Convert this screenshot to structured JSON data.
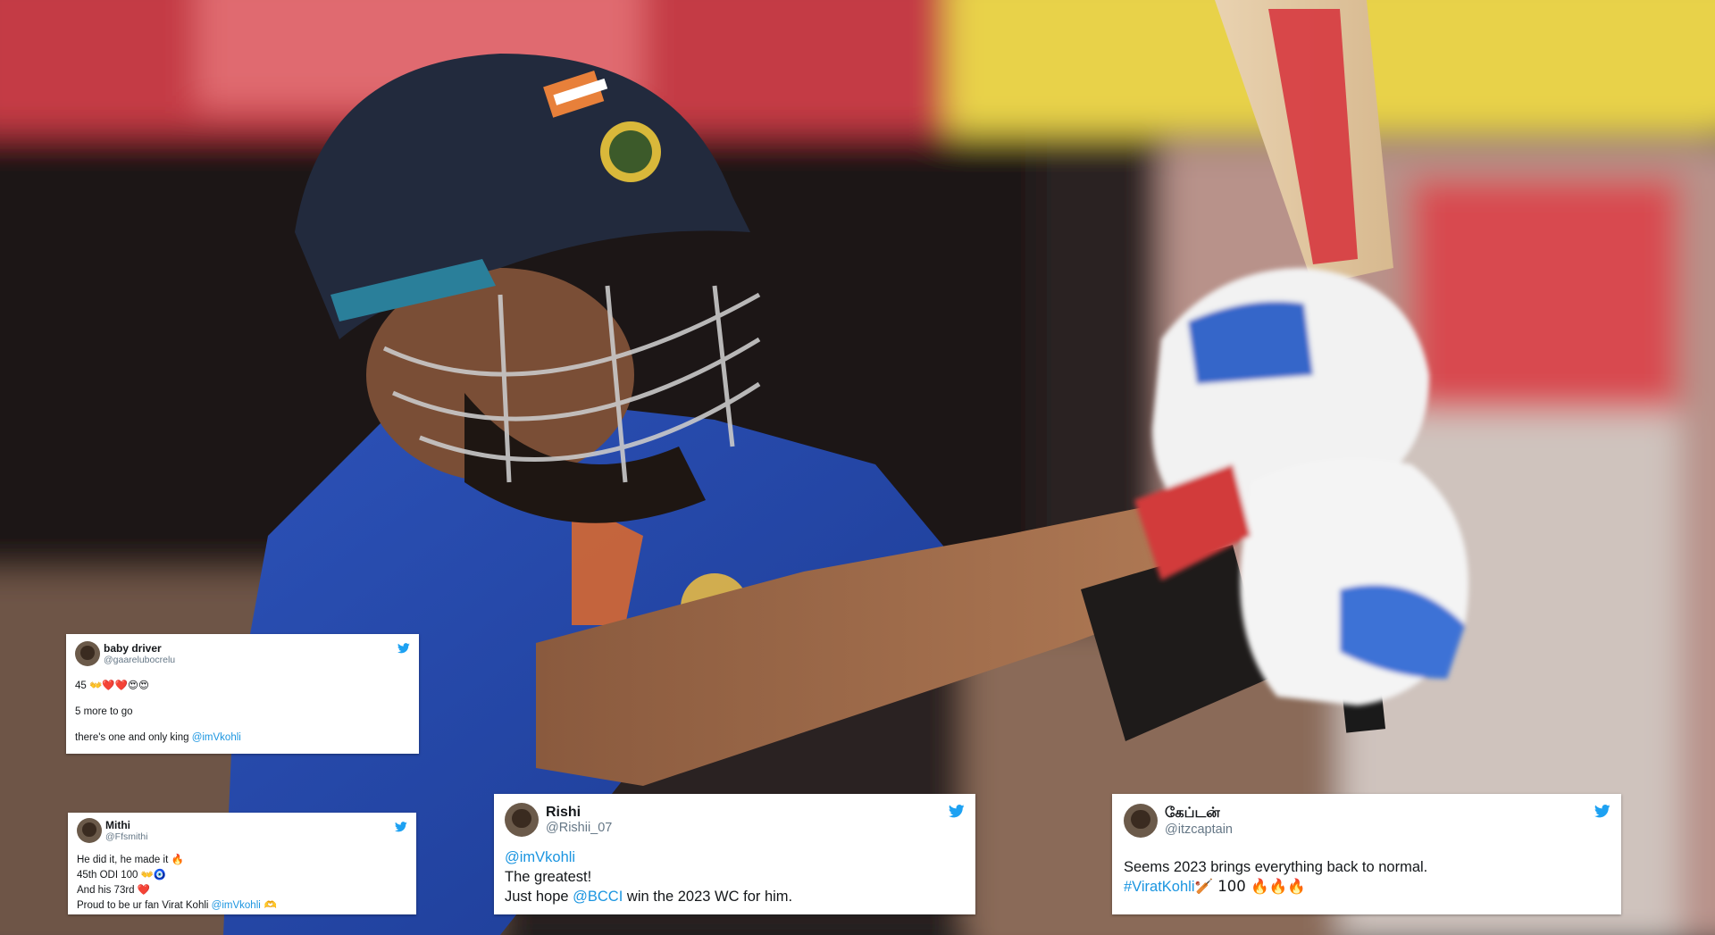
{
  "tweets": {
    "baby_driver": {
      "name": "baby driver",
      "handle": "@gaarelubocrelu",
      "line1_text": "45 ",
      "line1_emoji": "👐❤️❤️😍😍",
      "line2": "5 more to go",
      "line3_text": "there's one and only king ",
      "line3_mention": "@imVkohli"
    },
    "mithi": {
      "name": "Mithi",
      "handle": "@Ffsmithi",
      "line1_text": "He did it, he made it ",
      "line1_emoji": "🔥",
      "line2_text": "45th ODI 100 ",
      "line2_emoji": "👐🧿",
      "line3_text": "And his 73rd ",
      "line3_emoji": "❤️",
      "line4_text": "Proud to be ur fan Virat Kohli ",
      "line4_mention": "@imVkohli",
      "line4_end": " 🫶"
    },
    "rishi": {
      "name": "Rishi",
      "handle": "@Rishii_07",
      "line1_mention": "@imVkohli",
      "line2": "The greatest!",
      "line3_text": "Just hope ",
      "line3_mention": "@BCCI",
      "line3_end": " win the 2023 WC for him."
    },
    "captain": {
      "name": "கேப்டன்",
      "handle": "@itzcaptain",
      "line1": "Seems 2023 brings everything back to normal.",
      "line2_hashtag": "#ViratKohli",
      "line2_text": "🏏 100 ",
      "line2_emoji": "🔥🔥🔥"
    }
  },
  "icons": {
    "twitter_bird": "twitter-bird-icon"
  },
  "colors": {
    "link": "#1b95e0",
    "twitter_blue": "#1da1f2"
  }
}
